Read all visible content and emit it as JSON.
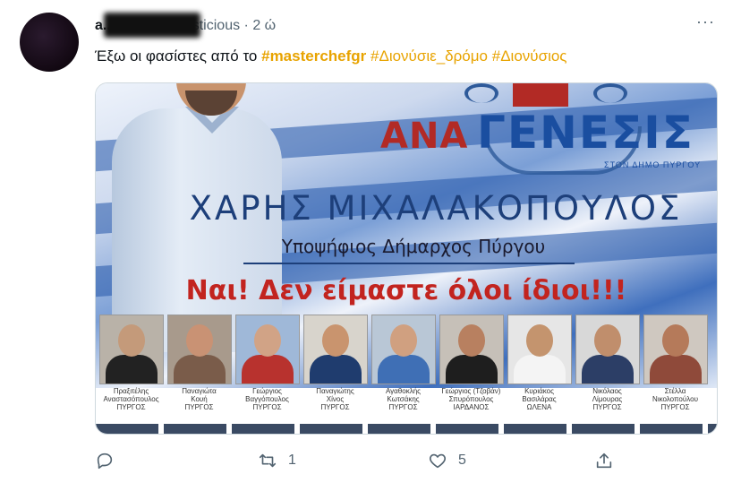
{
  "tweet": {
    "display_name": "a...ous",
    "handle": "@_littlesticious",
    "separator": "·",
    "time": "2 ώ",
    "more": "···",
    "text_prefix": "Έξω οι φασίστες από το ",
    "hashtags": [
      "#masterchefgr",
      "#Διονύσιε_δρόμο",
      "#Διονύσιος"
    ]
  },
  "image": {
    "logo_left": "ΑΝΑ",
    "logo_right": "ΓΕΝΕΣΙΣ",
    "logo_sub": "ΣΤΟΝ ΔΗΜΟ ΠΥΡΓΟΥ",
    "candidate_name": "ΧΑΡΗΣ ΜΙΧΑΛΑΚΟΠΟΥΛΟΣ",
    "candidate_title": "Υποψήφιος Δήμαρχος Πύργου",
    "slogan": "Ναι! Δεν είμαστε όλοι ίδιοι!!!",
    "people": [
      {
        "line1": "Πραξιτέλης",
        "line2": "Αναστασόπουλος",
        "line3": "ΠΥΡΓΟΣ"
      },
      {
        "line1": "Παναγιώτα",
        "line2": "Κουή",
        "line3": "ΠΥΡΓΟΣ"
      },
      {
        "line1": "Γεώργιος",
        "line2": "Βαγγόπουλος",
        "line3": "ΠΥΡΓΟΣ"
      },
      {
        "line1": "Παναγιώτης",
        "line2": "Χίνος",
        "line3": "ΠΥΡΓΟΣ"
      },
      {
        "line1": "Αγαθοκλής",
        "line2": "Κωτσάκης",
        "line3": "ΠΥΡΓΟΣ"
      },
      {
        "line1": "Γεώργιος (Τζοβάν)",
        "line2": "Σπυρόπουλος",
        "line3": "ΙΑΡΔΑΝΟΣ"
      },
      {
        "line1": "Κυριάκος",
        "line2": "Βασιλάρας",
        "line3": "ΩΛΕΝΑ"
      },
      {
        "line1": "Νικόλαος",
        "line2": "Λίμουρας",
        "line3": "ΠΥΡΓΟΣ"
      },
      {
        "line1": "Στέλλα",
        "line2": "Νικολοπούλου",
        "line3": "ΠΥΡΓΟΣ"
      }
    ]
  },
  "actions": {
    "retweet_count": "1",
    "like_count": "5"
  },
  "colors": {
    "hashtag": "#e8a300",
    "secondary_text": "#536471",
    "slogan_red": "#c2241f",
    "logo_blue": "#1a4ea0"
  },
  "icons": [
    "reply-icon",
    "retweet-icon",
    "like-icon",
    "share-icon",
    "more-icon"
  ]
}
